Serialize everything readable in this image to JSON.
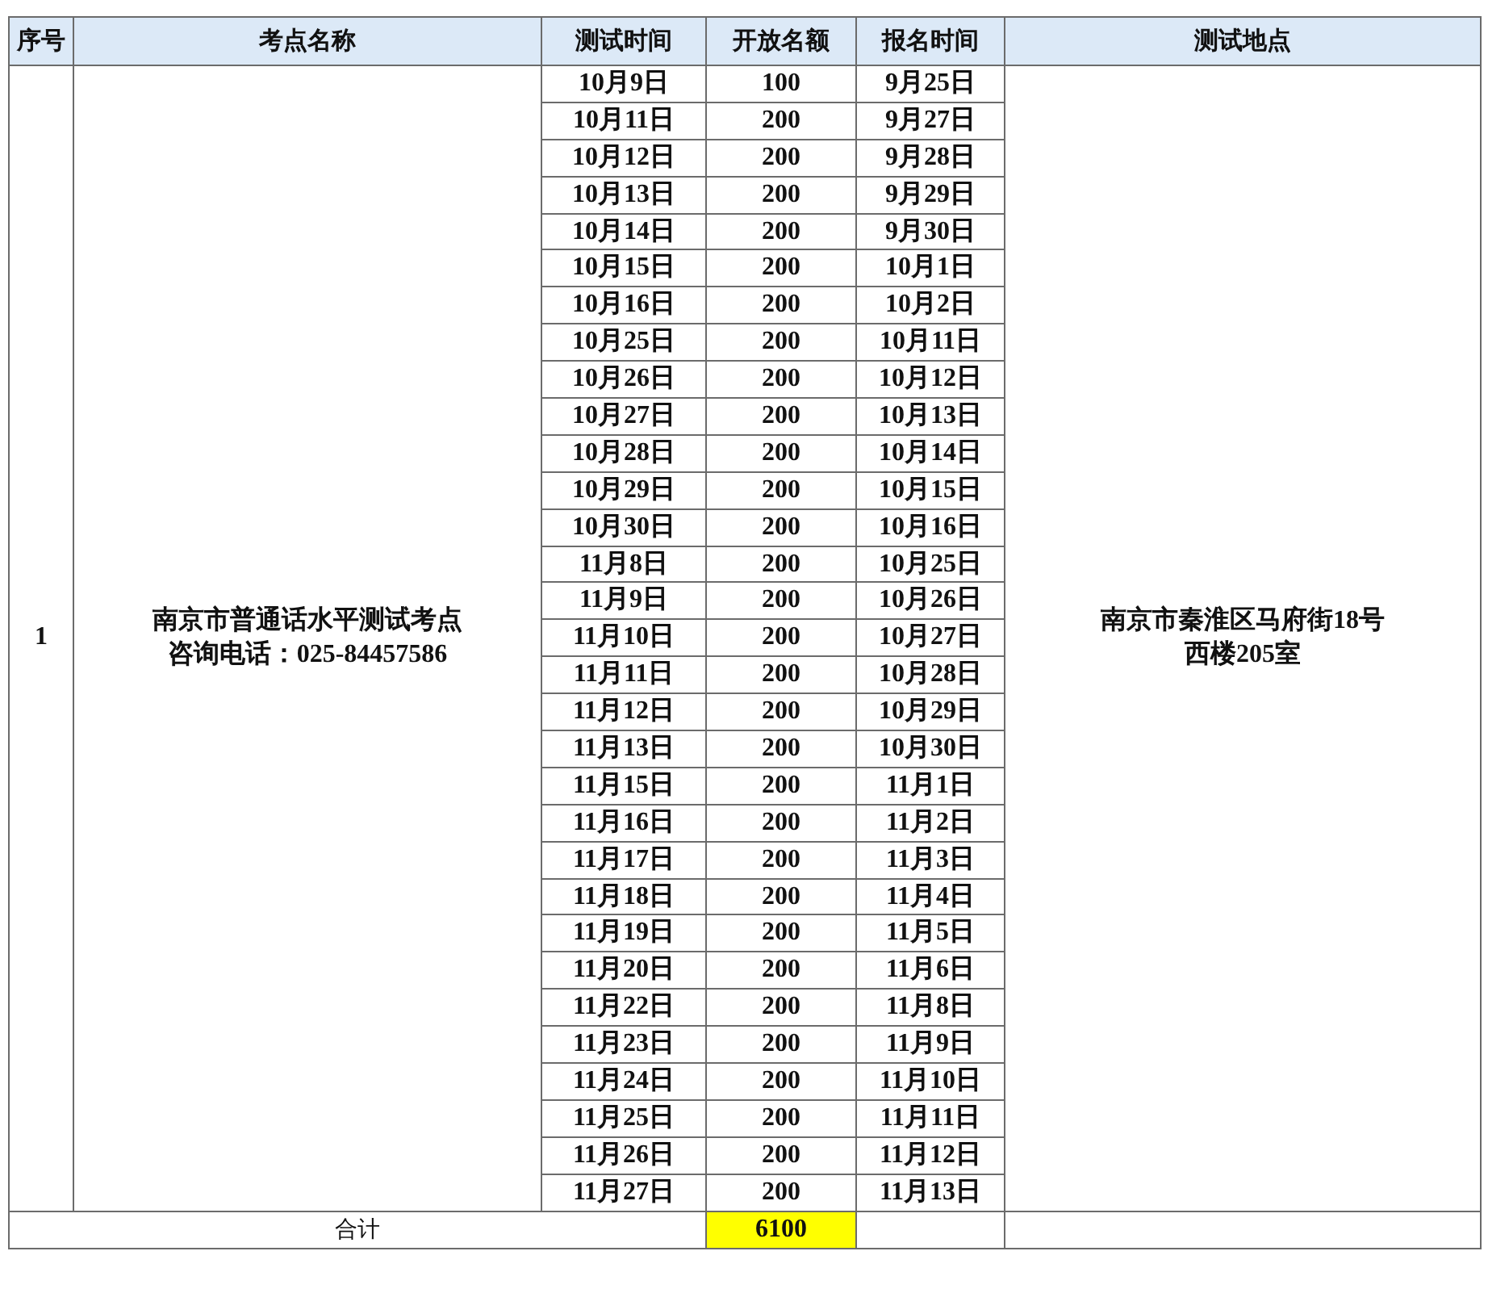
{
  "columns": [
    "序号",
    "考点名称",
    "测试时间",
    "开放名额",
    "报名时间",
    "测试地点"
  ],
  "site": {
    "index": "1",
    "name": "南京市普通话水平测试考点",
    "phone": "咨询电话：025-84457586",
    "location": [
      "南京市秦淮区马府街18号",
      "西楼205室"
    ]
  },
  "sessions": [
    [
      "10月9日",
      "100",
      "9月25日"
    ],
    [
      "10月11日",
      "200",
      "9月27日"
    ],
    [
      "10月12日",
      "200",
      "9月28日"
    ],
    [
      "10月13日",
      "200",
      "9月29日"
    ],
    [
      "10月14日",
      "200",
      "9月30日"
    ],
    [
      "10月15日",
      "200",
      "10月1日"
    ],
    [
      "10月16日",
      "200",
      "10月2日"
    ],
    [
      "10月25日",
      "200",
      "10月11日"
    ],
    [
      "10月26日",
      "200",
      "10月12日"
    ],
    [
      "10月27日",
      "200",
      "10月13日"
    ],
    [
      "10月28日",
      "200",
      "10月14日"
    ],
    [
      "10月29日",
      "200",
      "10月15日"
    ],
    [
      "10月30日",
      "200",
      "10月16日"
    ],
    [
      "11月8日",
      "200",
      "10月25日"
    ],
    [
      "11月9日",
      "200",
      "10月26日"
    ],
    [
      "11月10日",
      "200",
      "10月27日"
    ],
    [
      "11月11日",
      "200",
      "10月28日"
    ],
    [
      "11月12日",
      "200",
      "10月29日"
    ],
    [
      "11月13日",
      "200",
      "10月30日"
    ],
    [
      "11月15日",
      "200",
      "11月1日"
    ],
    [
      "11月16日",
      "200",
      "11月2日"
    ],
    [
      "11月17日",
      "200",
      "11月3日"
    ],
    [
      "11月18日",
      "200",
      "11月4日"
    ],
    [
      "11月19日",
      "200",
      "11月5日"
    ],
    [
      "11月20日",
      "200",
      "11月6日"
    ],
    [
      "11月22日",
      "200",
      "11月8日"
    ],
    [
      "11月23日",
      "200",
      "11月9日"
    ],
    [
      "11月24日",
      "200",
      "11月10日"
    ],
    [
      "11月25日",
      "200",
      "11月11日"
    ],
    [
      "11月26日",
      "200",
      "11月12日"
    ],
    [
      "11月27日",
      "200",
      "11月13日"
    ]
  ],
  "total": {
    "label": "合计",
    "value": "6100",
    "highlighted": true
  }
}
